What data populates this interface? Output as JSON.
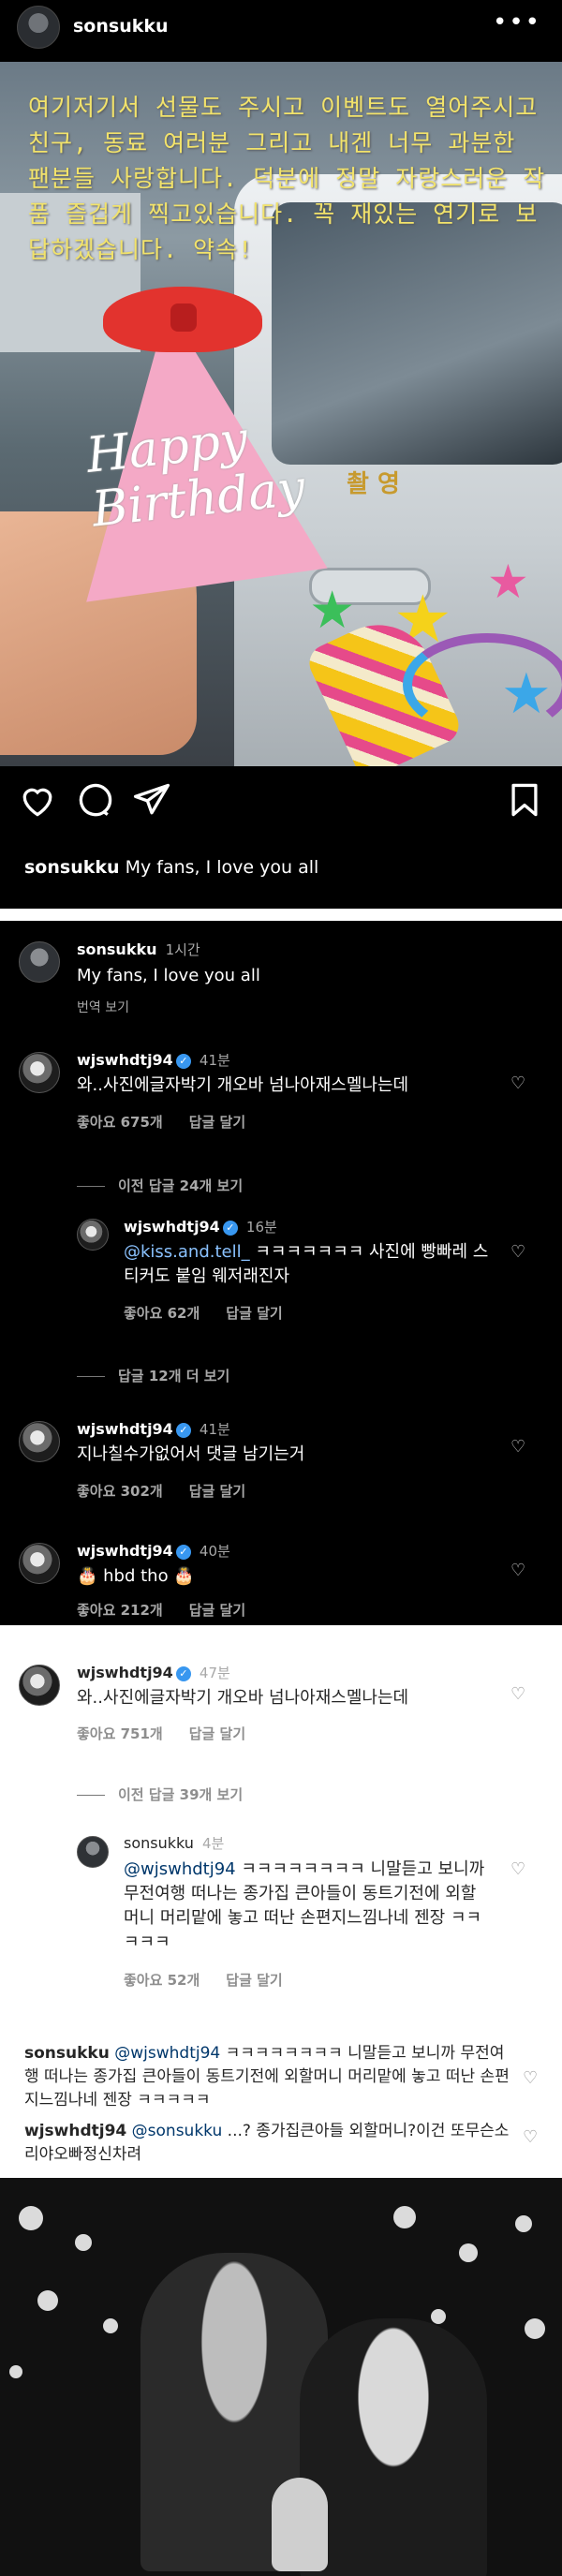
{
  "post": {
    "username": "sonsukku",
    "photo_caption": "여기저기서 선물도 주시고 이벤트도 열어주시고 친구, 동료 여러분 그리고 내겐 너무 과분한 팬분들 사랑합니다. 덕분에 정말 자랑스러운 작품 즐겁게 찍고있습니다. 꼭 재있는 연기로 보답하겠습니다. 약속!",
    "photo_text_happy": "Happy",
    "photo_text_birthday": "Birthday",
    "bus_label": "촬 영",
    "caption_text": "My fans, I love you all"
  },
  "comments_dark": {
    "top_comment": {
      "username": "sonsukku",
      "time": "1시간",
      "text": "My fans, I love you all",
      "translate": "번역 보기"
    },
    "c1": {
      "username": "wjswhdtj94",
      "time": "41분",
      "text": "와..사진에글자박기 개오바 넘나아재스멜나는데",
      "likes": "좋아요 675개",
      "reply": "답글 달기"
    },
    "prev_replies": "이전 답글 24개 보기",
    "r1": {
      "username": "wjswhdtj94",
      "time": "16분",
      "mention": "@kiss.and.tell_",
      "text": " ㅋㅋㅋㅋㅋㅋㅋ 사진에 빵빠레 스티커도 붙임 웨저래진자",
      "likes": "좋아요 62개",
      "reply": "답글 달기"
    },
    "more_replies": "답글 12개 더 보기",
    "c2": {
      "username": "wjswhdtj94",
      "time": "41분",
      "text": "지나칠수가없어서 댓글 남기는거",
      "likes": "좋아요 302개",
      "reply": "답글 달기"
    },
    "c3": {
      "username": "wjswhdtj94",
      "time": "40분",
      "text": "🎂 hbd tho 🎂",
      "likes": "좋아요 212개",
      "reply": "답글 달기"
    }
  },
  "comments_light": {
    "c1": {
      "username": "wjswhdtj94",
      "time": "47분",
      "text": "와..사진에글자박기 개오바 넘나아재스멜나는데",
      "likes": "좋아요 751개",
      "reply": "답글 달기"
    },
    "prev_replies": "이전 답글 39개 보기",
    "r1": {
      "username": "sonsukku",
      "time": "4분",
      "mention": "@wjswhdtj94",
      "text": " ㅋㅋㅋㅋㅋㅋㅋㅋ 니말듣고 보니까 무전여행 떠나는 종가집 큰아들이 동트기전에 외할머니 머리맡에 놓고 떠난 손편지느낌나네 젠장 ㅋㅋㅋㅋㅋ",
      "likes": "좋아요 52개",
      "reply": "답글 달기"
    },
    "flat1": {
      "username": "sonsukku",
      "mention": "@wjswhdtj94",
      "text": " ㅋㅋㅋㅋㅋㅋㅋㅋ 니말듣고 보니까 무전여행 떠나는 종가집 큰아들이 동트기전에 외할머니 머리맡에 놓고 떠난 손편지느낌나네 젠장 ㅋㅋㅋㅋㅋ"
    },
    "flat2": {
      "username": "wjswhdtj94",
      "mention": "@sonsukku",
      "text": " ...? 종가집큰아들 외할머니?이건 또무슨소리야오빠정신차려"
    }
  },
  "colors": {
    "verified": "#3897f0",
    "dark_bg": "#000000",
    "light_bg": "#ffffff"
  },
  "icons": [
    "more-icon",
    "heart-icon",
    "comment-icon",
    "share-icon",
    "bookmark-icon",
    "verified-icon"
  ]
}
